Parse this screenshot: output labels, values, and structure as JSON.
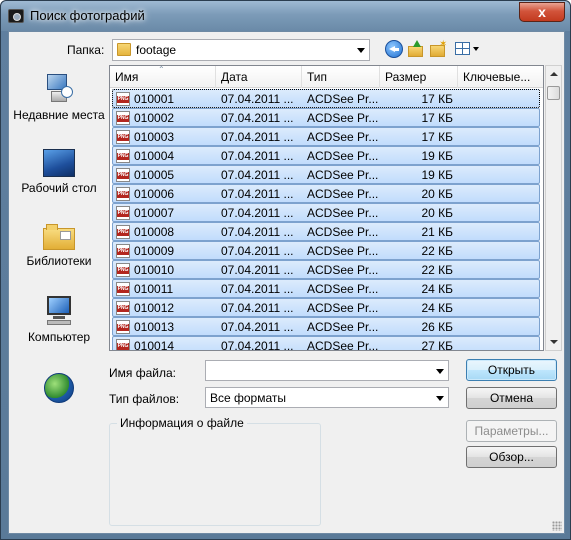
{
  "window": {
    "title": "Поиск фотографий",
    "close_glyph": "x"
  },
  "folder": {
    "label": "Папка:",
    "current": "footage"
  },
  "places": [
    {
      "label": "Недавние места",
      "icon": "recent-places-icon"
    },
    {
      "label": "Рабочий стол",
      "icon": "desktop-icon"
    },
    {
      "label": "Библиотеки",
      "icon": "libraries-icon"
    },
    {
      "label": "Компьютер",
      "icon": "computer-icon"
    },
    {
      "label": "",
      "icon": "network-icon"
    }
  ],
  "columns": [
    "Имя",
    "Дата",
    "Тип",
    "Размер",
    "Ключевые..."
  ],
  "files": [
    {
      "name": "010001",
      "date": "07.04.2011 ...",
      "type": "ACDSee Pr...",
      "size": "17 КБ"
    },
    {
      "name": "010002",
      "date": "07.04.2011 ...",
      "type": "ACDSee Pr...",
      "size": "17 КБ"
    },
    {
      "name": "010003",
      "date": "07.04.2011 ...",
      "type": "ACDSee Pr...",
      "size": "17 КБ"
    },
    {
      "name": "010004",
      "date": "07.04.2011 ...",
      "type": "ACDSee Pr...",
      "size": "19 КБ"
    },
    {
      "name": "010005",
      "date": "07.04.2011 ...",
      "type": "ACDSee Pr...",
      "size": "19 КБ"
    },
    {
      "name": "010006",
      "date": "07.04.2011 ...",
      "type": "ACDSee Pr...",
      "size": "20 КБ"
    },
    {
      "name": "010007",
      "date": "07.04.2011 ...",
      "type": "ACDSee Pr...",
      "size": "20 КБ"
    },
    {
      "name": "010008",
      "date": "07.04.2011 ...",
      "type": "ACDSee Pr...",
      "size": "21 КБ"
    },
    {
      "name": "010009",
      "date": "07.04.2011 ...",
      "type": "ACDSee Pr...",
      "size": "22 КБ"
    },
    {
      "name": "010010",
      "date": "07.04.2011 ...",
      "type": "ACDSee Pr...",
      "size": "22 КБ"
    },
    {
      "name": "010011",
      "date": "07.04.2011 ...",
      "type": "ACDSee Pr...",
      "size": "24 КБ"
    },
    {
      "name": "010012",
      "date": "07.04.2011 ...",
      "type": "ACDSee Pr...",
      "size": "24 КБ"
    },
    {
      "name": "010013",
      "date": "07.04.2011 ...",
      "type": "ACDSee Pr...",
      "size": "26 КБ"
    },
    {
      "name": "010014",
      "date": "07.04.2011 ...",
      "type": "ACDSee Pr...",
      "size": "27 КБ"
    }
  ],
  "form": {
    "filename_label": "Имя файла:",
    "filename_value": "",
    "filetype_label": "Тип файлов:",
    "filetype_value": "Все форматы",
    "info_title": "Информация о файле"
  },
  "buttons": {
    "open": "Открыть",
    "cancel": "Отмена",
    "params": "Параметры...",
    "browse": "Обзор..."
  },
  "colors": {
    "selection_fill": "#c1dcfc",
    "selection_border": "#7da2ce",
    "titlebar": "#7c9bb8",
    "close_button": "#c23a1f"
  }
}
